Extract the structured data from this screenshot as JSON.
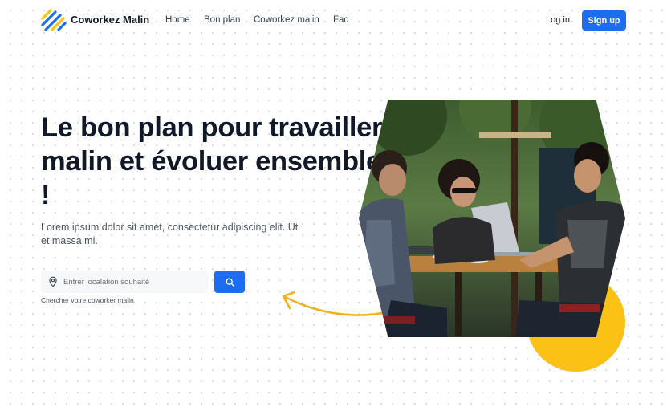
{
  "header": {
    "brand": "Coworkez Malin",
    "nav": [
      "Home",
      "Bon plan",
      "Coworkez malin",
      "Faq"
    ],
    "login_label": "Log in",
    "signup_label": "Sign up"
  },
  "hero": {
    "title": "Le bon plan pour travailler malin et évoluer ensemble !",
    "subtitle": "Lorem ipsum dolor sit amet, consectetur adipiscing elit. Ut et massa mi.",
    "search": {
      "placeholder": "Entrer localation souhaité",
      "hint": "Chercher votre coworker malin"
    }
  },
  "icons": [
    "logo-icon",
    "location-pin-icon",
    "search-icon",
    "curved-arrow-icon"
  ],
  "colors": {
    "primary": "#1d6df2",
    "accent": "#fbc114",
    "heading": "#111827"
  }
}
